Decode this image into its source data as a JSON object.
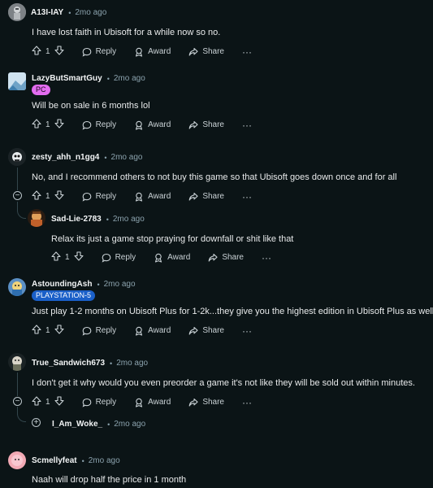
{
  "colors": {
    "background": "#0b1416",
    "pc_flair": "#e36cf0",
    "ps5_flair": "#1a5fc8"
  },
  "action_labels": {
    "reply": "Reply",
    "award": "Award",
    "share": "Share",
    "more": "···"
  },
  "comments": [
    {
      "username": "A13I-IAY",
      "time": "2mo ago",
      "text": "I have lost faith in Ubisoft for a while now so no.",
      "votes": "1"
    },
    {
      "username": "LazyButSmartGuy",
      "time": "2mo ago",
      "flair": "PC",
      "text": "Will be on sale in 6 months lol",
      "votes": "1"
    },
    {
      "username": "zesty_ahh_n1gg4",
      "time": "2mo ago",
      "text": "No, and I recommend others to not buy this game so that Ubisoft goes down once and for all",
      "votes": "1"
    },
    {
      "username": "Sad-Lie-2783",
      "time": "2mo ago",
      "text": "Relax its just a game stop praying for downfall or shit like that",
      "votes": "1"
    },
    {
      "username": "AstoundingAsh",
      "time": "2mo ago",
      "flair": "PLAYSTATION-5",
      "text": "Just play 1-2 months on Ubisoft Plus for 1-2k...they give you the highest edition in Ubisoft Plus as well",
      "votes": "1"
    },
    {
      "username": "True_Sandwich673",
      "time": "2mo ago",
      "text": "I don't get it why would you even preorder a game it's not like they will be sold out within minutes.",
      "votes": "1"
    },
    {
      "username": "I_Am_Woke_",
      "time": "2mo ago"
    },
    {
      "username": "Scmellyfeat",
      "time": "2mo ago",
      "text": "Naah will drop half the price in 1 month"
    }
  ]
}
